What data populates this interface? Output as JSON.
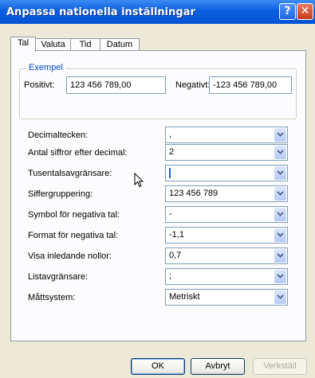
{
  "window": {
    "title": "Anpassa nationella inställningar",
    "help_glyph": "?",
    "close_glyph": "✕"
  },
  "tabs": [
    "Tal",
    "Valuta",
    "Tid",
    "Datum"
  ],
  "example": {
    "legend": "Exempel",
    "positive_label": "Positivt:",
    "positive_value": "123 456 789,00",
    "negative_label": "Negativt:",
    "negative_value": "-123 456 789,00"
  },
  "settings": [
    {
      "label": "Decimaltecken:",
      "value": ","
    },
    {
      "label": "Antal siffror efter decimal:",
      "value": "2"
    },
    {
      "label": "Tusentalsavgränsare:",
      "value": ""
    },
    {
      "label": "Siffergruppering:",
      "value": "123 456 789"
    },
    {
      "label": "Symbol för negativa tal:",
      "value": "-"
    },
    {
      "label": "Format för negativa tal:",
      "value": "-1,1"
    },
    {
      "label": "Visa inledande nollor:",
      "value": "0,7"
    },
    {
      "label": "Listavgränsare:",
      "value": ";"
    },
    {
      "label": "Måttsystem:",
      "value": "Metriskt"
    }
  ],
  "buttons": {
    "ok": "OK",
    "cancel": "Avbryt",
    "apply": "Verkställ"
  }
}
